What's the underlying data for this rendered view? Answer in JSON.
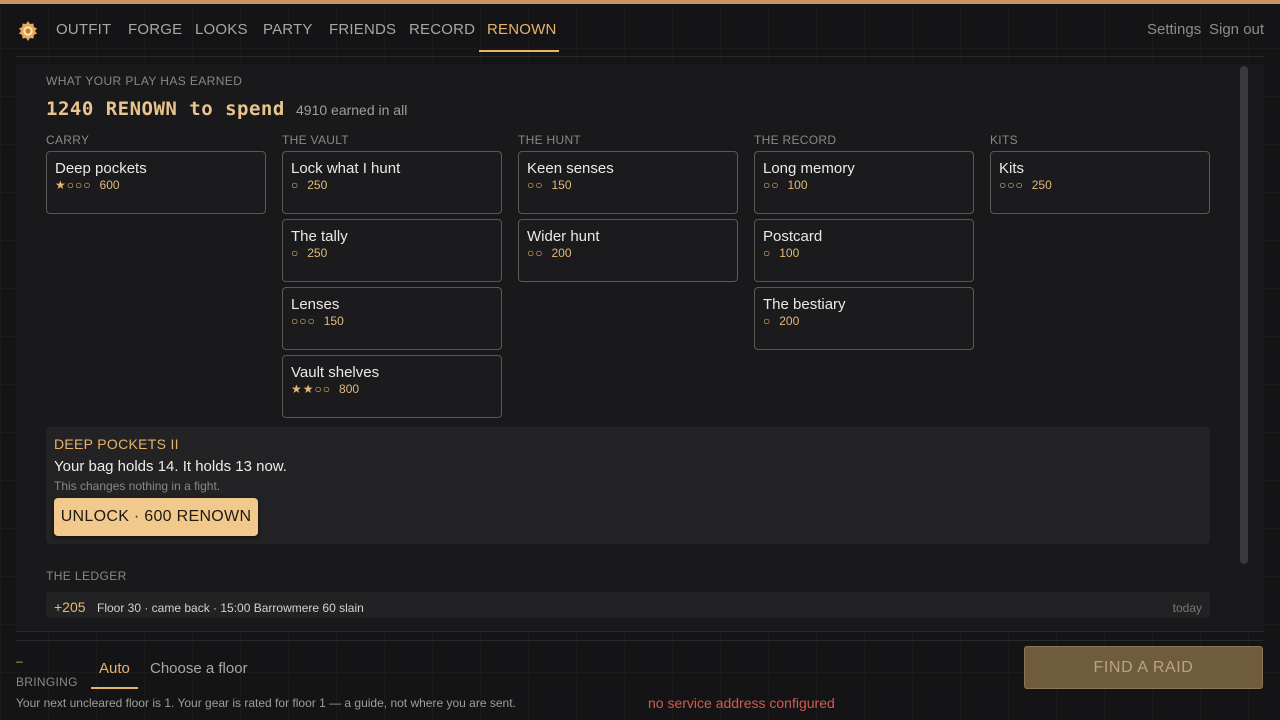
{
  "nav": {
    "items": [
      "OUTFIT",
      "FORGE",
      "LOOKS",
      "PARTY",
      "FRIENDS",
      "RECORD",
      "RENOWN"
    ],
    "active": "RENOWN",
    "settings": "Settings",
    "sign_out": "Sign out",
    "logo_icon": "sun-gear-icon"
  },
  "renown": {
    "eyebrow": "WHAT YOUR PLAY HAS EARNED",
    "headline": "1240 RENOWN to spend",
    "earned": "4910 earned in all"
  },
  "columns": [
    {
      "title": "CARRY",
      "cards": [
        {
          "name": "Deep pockets",
          "pips": "★○○○",
          "cost": "600"
        }
      ]
    },
    {
      "title": "THE VAULT",
      "cards": [
        {
          "name": "Lock what I hunt",
          "pips": "○",
          "cost": "250"
        },
        {
          "name": "The tally",
          "pips": "○",
          "cost": "250"
        },
        {
          "name": "Lenses",
          "pips": "○○○",
          "cost": "150"
        },
        {
          "name": "Vault shelves",
          "pips": "★★○○",
          "cost": "800"
        }
      ]
    },
    {
      "title": "THE HUNT",
      "cards": [
        {
          "name": "Keen senses",
          "pips": "○○",
          "cost": "150"
        },
        {
          "name": "Wider hunt",
          "pips": "○○",
          "cost": "200"
        }
      ]
    },
    {
      "title": "THE RECORD",
      "cards": [
        {
          "name": "Long memory",
          "pips": "○○",
          "cost": "100"
        },
        {
          "name": "Postcard",
          "pips": "○",
          "cost": "100"
        },
        {
          "name": "The bestiary",
          "pips": "○",
          "cost": "200"
        }
      ]
    },
    {
      "title": "KITS",
      "cards": [
        {
          "name": "Kits",
          "pips": "○○○",
          "cost": "250"
        }
      ]
    }
  ],
  "detail": {
    "title": "DEEP POCKETS II",
    "body": "Your bag holds 14. It holds 13 now.",
    "note": "This changes nothing in a fight.",
    "unlock_label": "UNLOCK · 600 RENOWN"
  },
  "ledger": {
    "title": "THE LEDGER",
    "rows": [
      {
        "amount": "+205",
        "text": "Floor 30 · came back · 15:00  Barrowmere  60 slain",
        "when": "today"
      }
    ]
  },
  "footer": {
    "dash": "–",
    "bringing": "BRINGING",
    "tabs": [
      "Auto",
      "Choose a floor"
    ],
    "active_tab": "Auto",
    "find_raid": "FIND A RAID",
    "hint": "Your next uncleared floor is 1. Your gear is rated for floor 1 — a guide, not where you are sent.",
    "error": "no service address configured"
  },
  "colors": {
    "accent": "#e8b36a",
    "button": "#f2c98c",
    "error": "#d25a4e"
  }
}
